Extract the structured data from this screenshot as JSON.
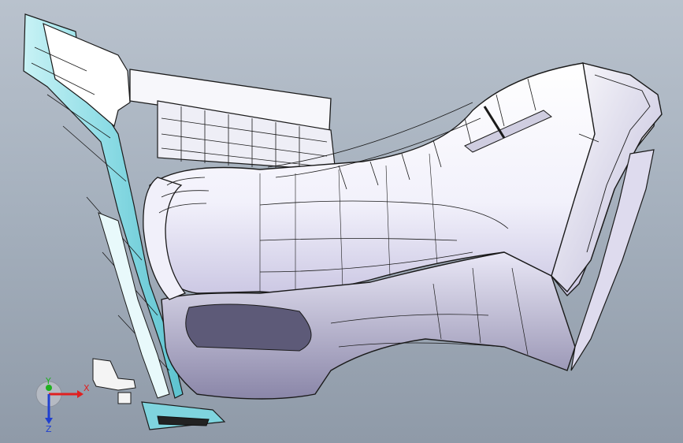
{
  "viewport": {
    "background_top": "#b9c2cd",
    "background_bottom": "#8f9aa8"
  },
  "model": {
    "surface_color": "#ffffff",
    "edge_color": "#1a1a1a",
    "shadow_color": "#6d6a85",
    "trim_color": "#9fe3ea"
  },
  "triad": {
    "x_label": "X",
    "y_label": "Y",
    "z_label": "Z",
    "x_color": "#e02020",
    "y_color": "#20b020",
    "z_color": "#2040d0"
  }
}
